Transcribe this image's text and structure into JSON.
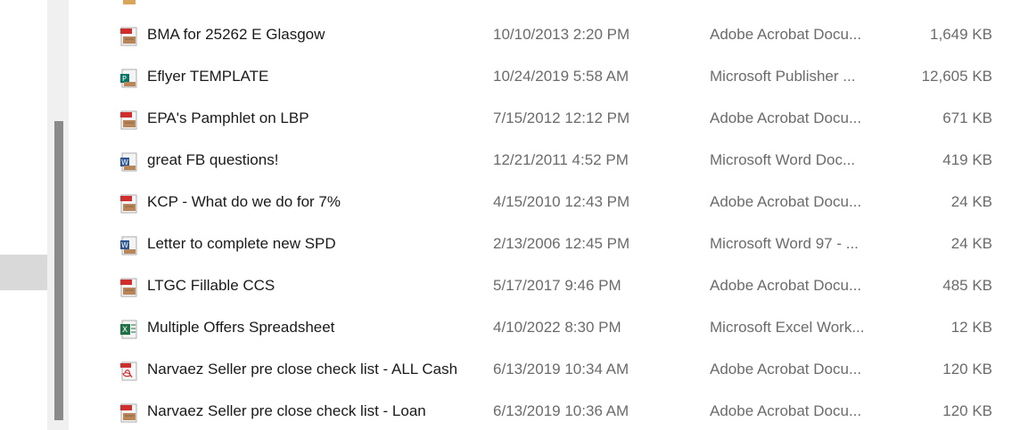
{
  "files": [
    {
      "name": "BMA for 25262 E Glasgow",
      "date": "10/10/2013 2:20 PM",
      "type": "Adobe Acrobat Docu...",
      "size": "1,649 KB",
      "icon": "pdf-icon"
    },
    {
      "name": "Eflyer TEMPLATE",
      "date": "10/24/2019 5:58 AM",
      "type": "Microsoft Publisher ...",
      "size": "12,605 KB",
      "icon": "publisher-icon"
    },
    {
      "name": "EPA's Pamphlet on LBP",
      "date": "7/15/2012 12:12 PM",
      "type": "Adobe Acrobat Docu...",
      "size": "671 KB",
      "icon": "pdf-icon"
    },
    {
      "name": "great FB questions!",
      "date": "12/21/2011 4:52 PM",
      "type": "Microsoft Word Doc...",
      "size": "419 KB",
      "icon": "word-icon"
    },
    {
      "name": "KCP - What do we do for 7%",
      "date": "4/15/2010 12:43 PM",
      "type": "Adobe Acrobat Docu...",
      "size": "24 KB",
      "icon": "pdf-icon"
    },
    {
      "name": "Letter to complete new SPD",
      "date": "2/13/2006 12:45 PM",
      "type": "Microsoft Word 97 - ...",
      "size": "24 KB",
      "icon": "word97-icon"
    },
    {
      "name": "LTGC Fillable CCS",
      "date": "5/17/2017 9:46 PM",
      "type": "Adobe Acrobat Docu...",
      "size": "485 KB",
      "icon": "pdf-icon"
    },
    {
      "name": "Multiple Offers Spreadsheet",
      "date": "4/10/2022 8:30 PM",
      "type": "Microsoft Excel Work...",
      "size": "12 KB",
      "icon": "excel-icon"
    },
    {
      "name": "Narvaez Seller pre close check list - ALL Cash",
      "date": "6/13/2019 10:34 AM",
      "type": "Adobe Acrobat Docu...",
      "size": "120 KB",
      "icon": "pdf-icon"
    },
    {
      "name": "Narvaez Seller pre close check list - Loan",
      "date": "6/13/2019 10:36 AM",
      "type": "Adobe Acrobat Docu...",
      "size": "120 KB",
      "icon": "pdf-icon"
    }
  ]
}
